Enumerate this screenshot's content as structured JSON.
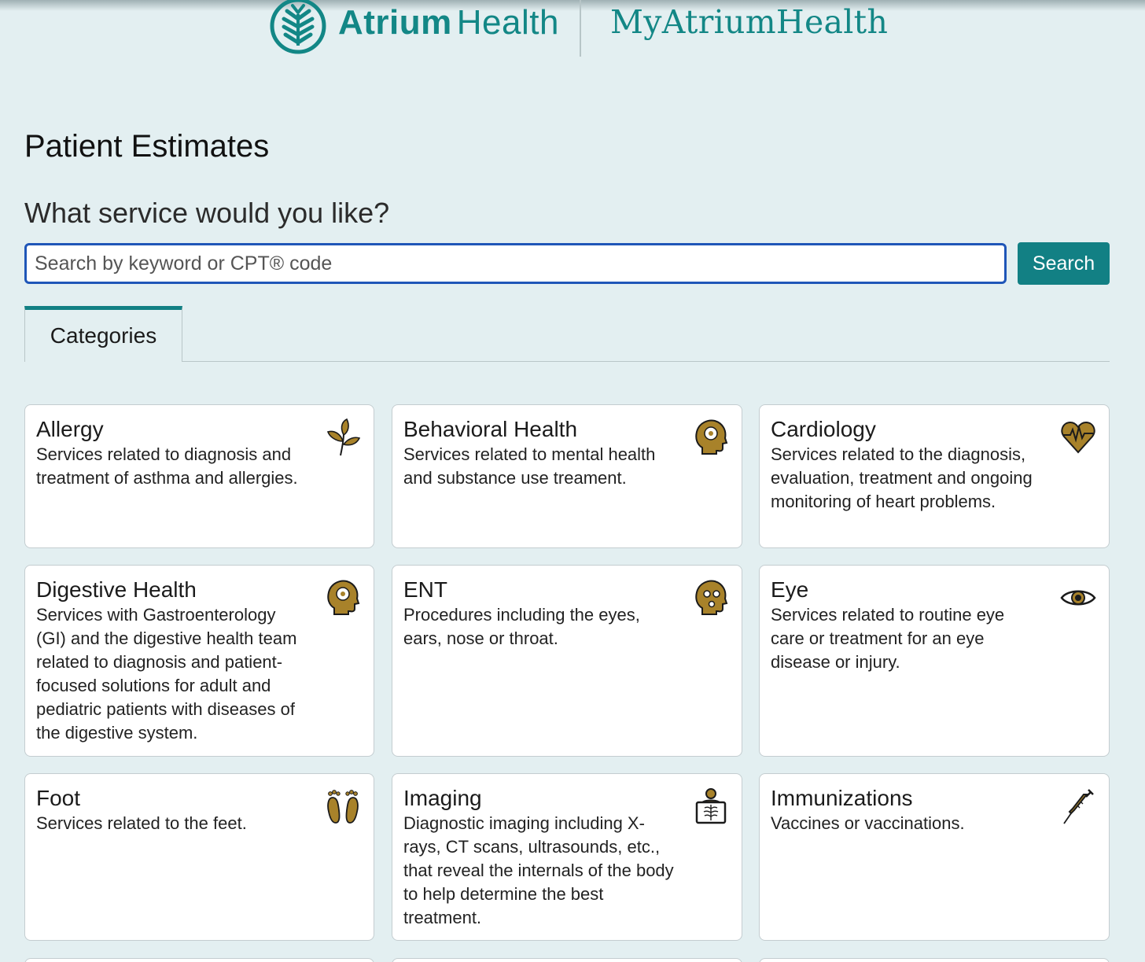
{
  "header": {
    "brand_bold": "Atrium",
    "brand_light": "Health",
    "portal_name": "MyAtriumHealth",
    "brand_color": "#138786"
  },
  "page": {
    "title": "Patient Estimates",
    "question": "What service would you like?"
  },
  "search": {
    "placeholder": "Search by keyword or CPT® code",
    "value": "",
    "button_label": "Search"
  },
  "tabs": [
    {
      "label": "Categories",
      "active": true
    }
  ],
  "categories": [
    {
      "title": "Allergy",
      "description": "Services related to diagnosis and treatment of asthma and allergies.",
      "icon": "leaf-icon"
    },
    {
      "title": "Behavioral Health",
      "description": "Services related to mental health and substance use treament.",
      "icon": "head-gear-icon"
    },
    {
      "title": "Cardiology",
      "description": "Services related to the diagnosis, evaluation, treatment and ongoing monitoring of heart problems.",
      "icon": "heart-pulse-icon"
    },
    {
      "title": "Digestive Health",
      "description": "Services with Gastroenterology (GI) and the digestive health team related to diagnosis and patient-focused solutions for adult and pediatric patients with diseases of the digestive system.",
      "icon": "head-gear-icon"
    },
    {
      "title": "ENT",
      "description": "Procedures including the eyes, ears, nose or throat.",
      "icon": "face-icon"
    },
    {
      "title": "Eye",
      "description": "Services related to routine eye care or treatment for an eye disease or injury.",
      "icon": "eye-icon"
    },
    {
      "title": "Foot",
      "description": "Services related to the feet.",
      "icon": "footprints-icon"
    },
    {
      "title": "Imaging",
      "description": "Diagnostic imaging including X-rays, CT scans, ultrasounds, etc., that reveal the internals of the body to help determine the best treatment.",
      "icon": "xray-icon"
    },
    {
      "title": "Immunizations",
      "description": "Vaccines or vaccinations.",
      "icon": "syringe-icon"
    }
  ],
  "icon_colors": {
    "gold": "#a8822a",
    "outline": "#1b1b1b"
  }
}
